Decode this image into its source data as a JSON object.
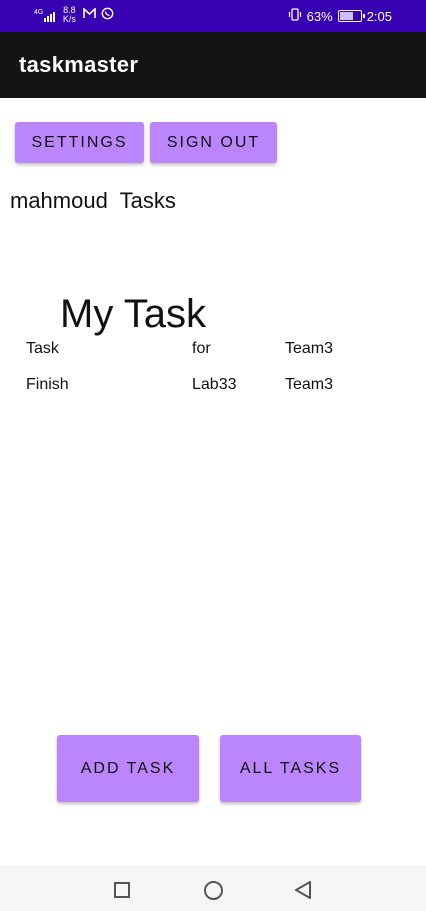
{
  "status_bar": {
    "network_label": "4G",
    "speed": "8.8\nK/s",
    "speed_value": "8.8",
    "speed_unit": "K/s",
    "battery_percent": "63%",
    "battery_level": 0.63,
    "time": "2:05",
    "icons": [
      "signal-icon",
      "mail-icon",
      "whatsapp-icon",
      "vibrate-icon",
      "battery-icon"
    ]
  },
  "app_bar": {
    "title": "taskmaster"
  },
  "top_buttons": {
    "settings_label": "SETTINGS",
    "sign_out_label": "SIGN OUT"
  },
  "user_tasks_heading": "mahmoud  Tasks",
  "task_list": {
    "title": "My Task",
    "rows": [
      {
        "col1": "Task",
        "col2": "for",
        "col3": "Team3"
      },
      {
        "col1": "Finish",
        "col2": "Lab33",
        "col3": "Team3"
      }
    ]
  },
  "bottom_buttons": {
    "add_task_label": "ADD TASK",
    "all_tasks_label": "ALL TASKS"
  },
  "nav_bar": {
    "icons": [
      "recent-apps-icon",
      "home-icon",
      "back-icon"
    ]
  },
  "colors": {
    "status_bar": "#3700b3",
    "app_bar": "#141414",
    "button": "#bb86fc"
  }
}
